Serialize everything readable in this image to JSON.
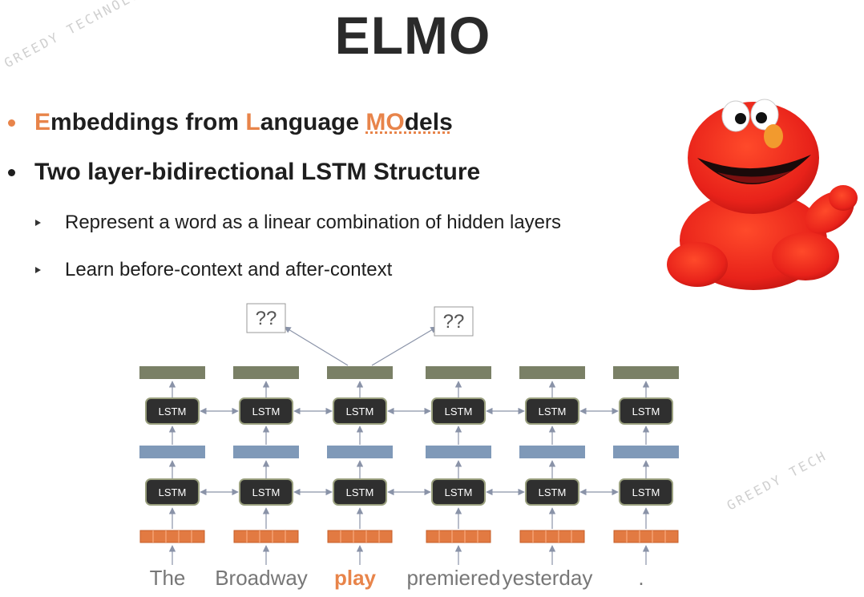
{
  "slide": {
    "title": "ELMO",
    "bullet1": {
      "p1": "E",
      "p2": "mbeddings from ",
      "p3": "L",
      "p4": "anguage ",
      "p5": "MO",
      "p6": "dels"
    },
    "bullet2": "Two layer-bidirectional LSTM Structure",
    "sub1": "Represent a word as a linear combination of hidden layers",
    "sub2": "Learn before-context and after-context",
    "watermark_top": "GREEDY TECHNOLOGY",
    "watermark_bottom": "GREEDY TECH"
  },
  "diagram": {
    "lstm_label": "LSTM",
    "question_label": "??",
    "words": [
      "The",
      "Broadway",
      "play",
      "premiered",
      "yesterday",
      "."
    ],
    "highlight_word": "play"
  },
  "colors": {
    "accent": "#e8844a",
    "lstm_box": "#2f2f2f",
    "hidden_blue": "#7f99b8",
    "output_green": "#7a8066",
    "embedding_orange": "#e27a42",
    "arrow": "#8a93a8"
  }
}
